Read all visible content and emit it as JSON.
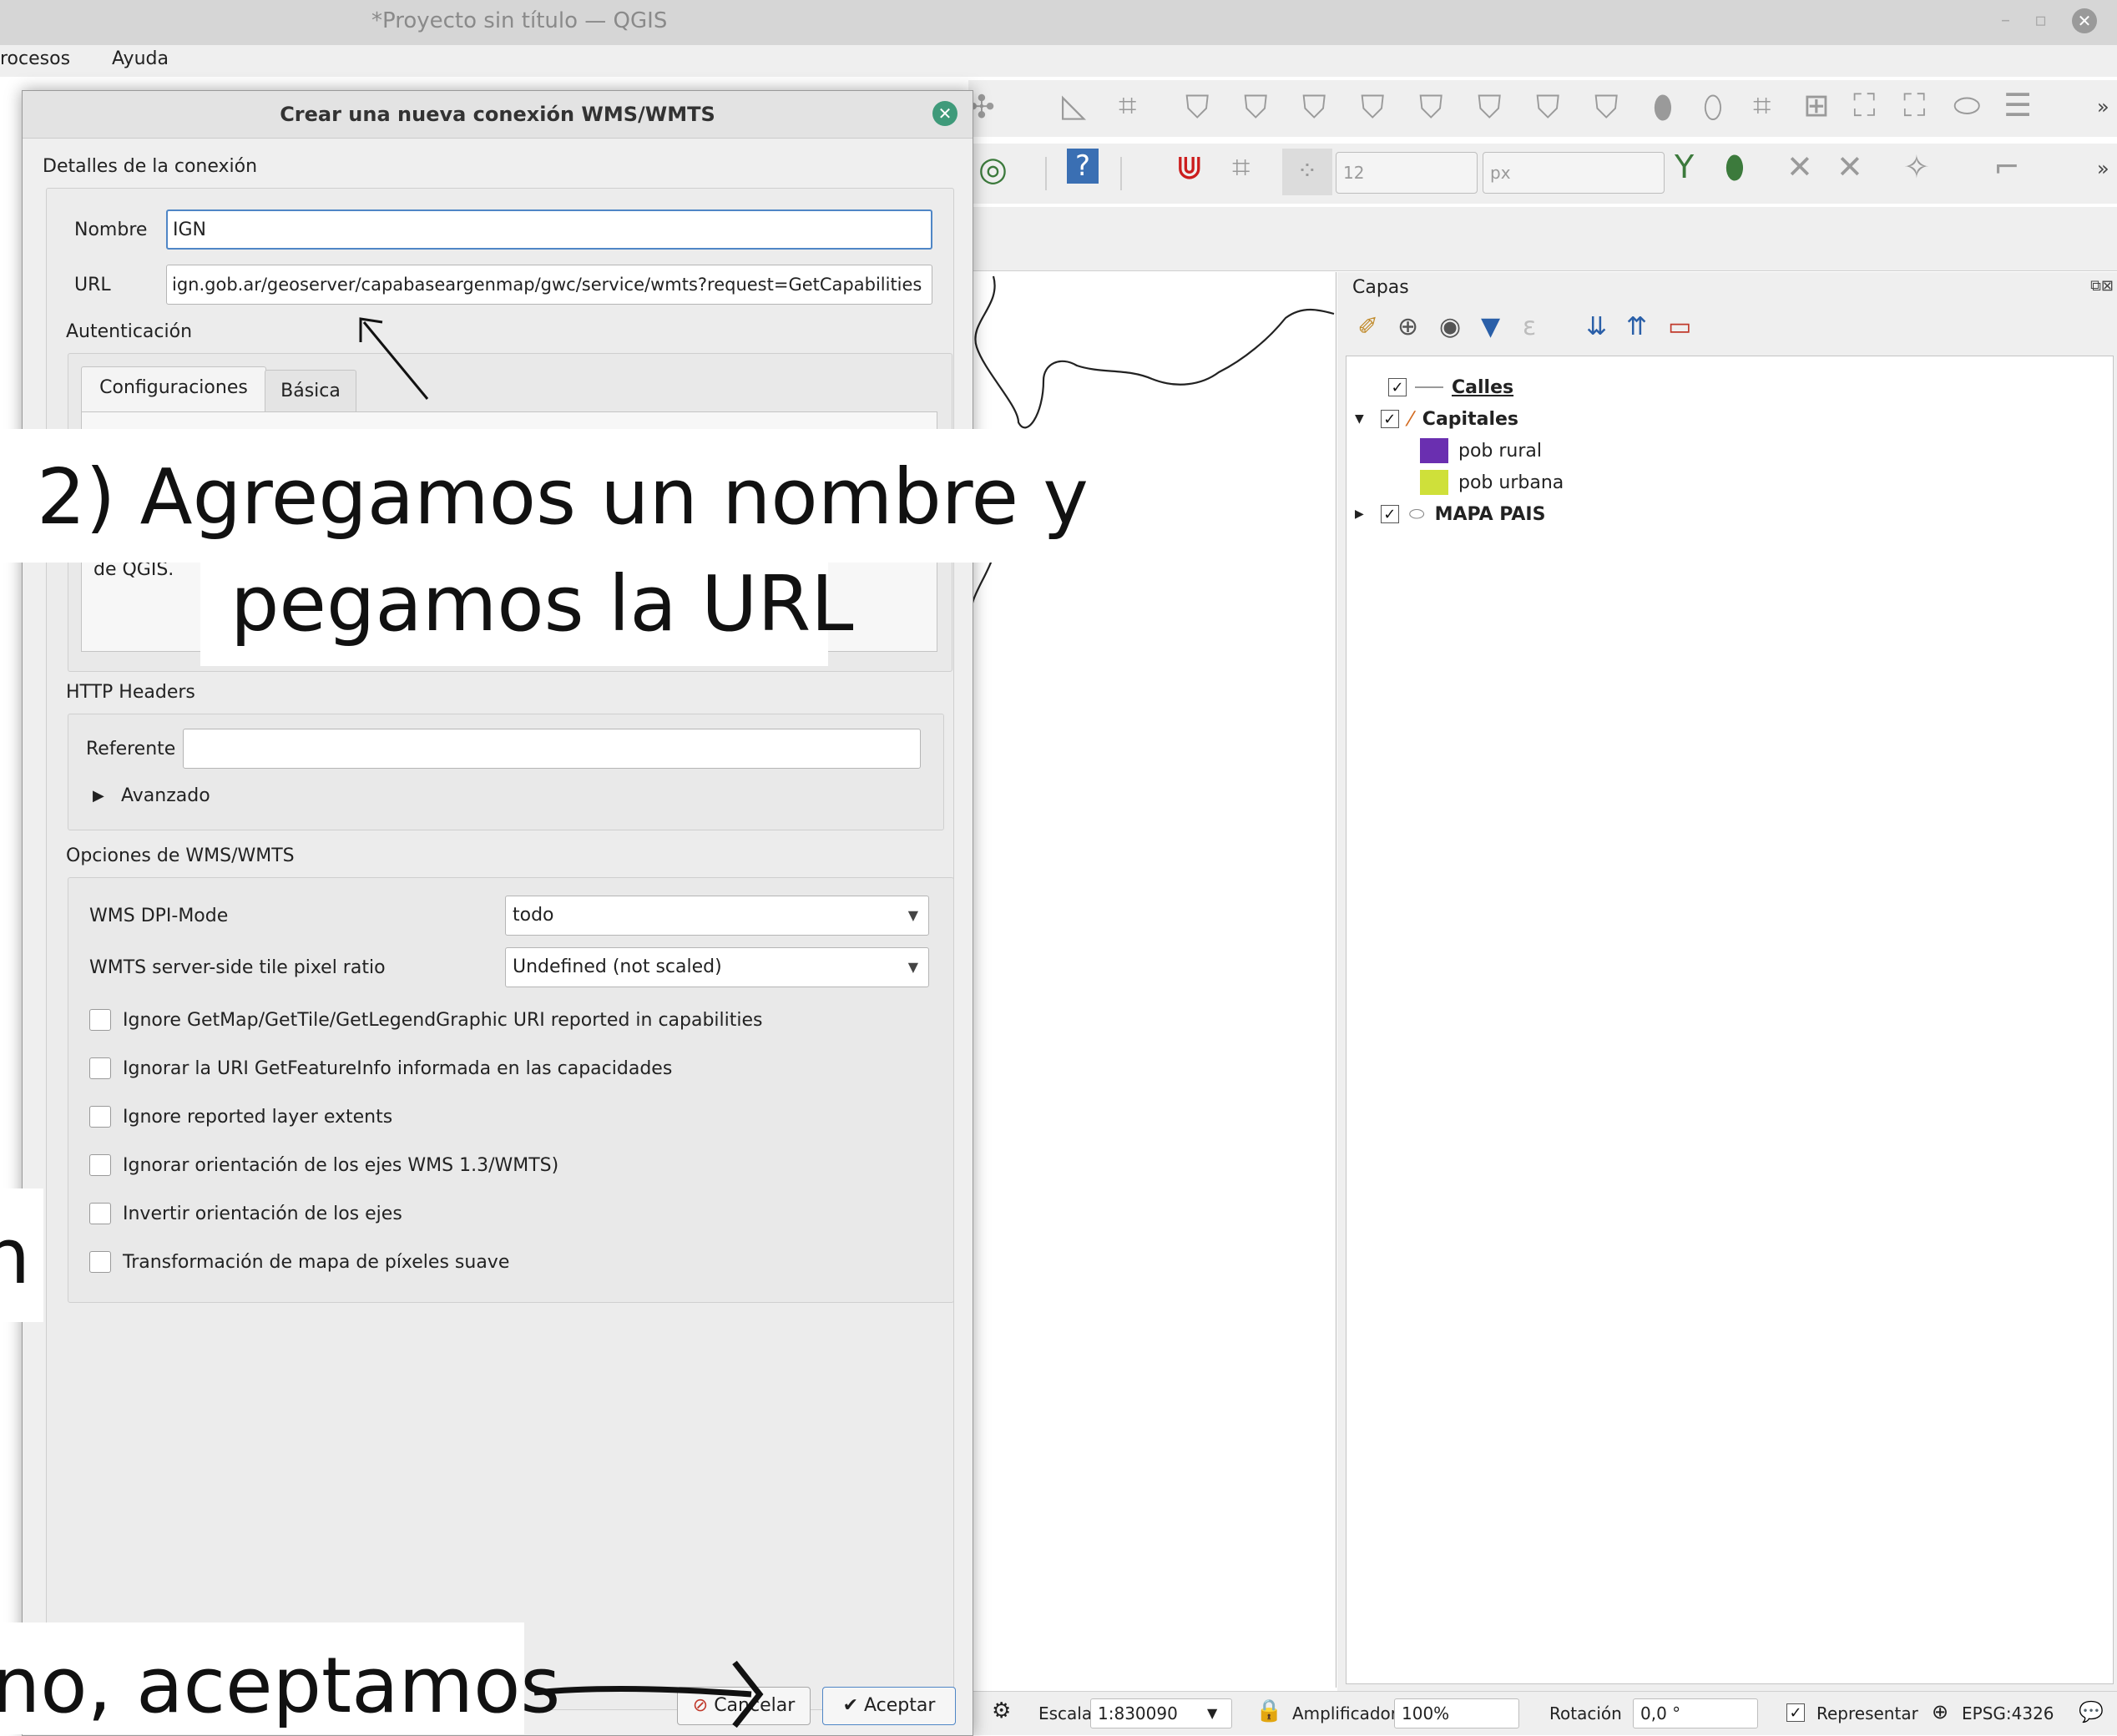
{
  "window": {
    "title": "*Proyecto sin título — QGIS",
    "min_glyph": "–",
    "max_glyph": "▫",
    "close_glyph": "✕"
  },
  "menu": {
    "items": [
      "rocesos",
      "Ayuda"
    ]
  },
  "toolbar": {
    "more_glyph": "»",
    "size_value": "12",
    "unit_value": "px"
  },
  "dialog": {
    "title": "Crear una nueva conexión WMS/WMTS",
    "section_details": "Detalles de la conexión",
    "name_label": "Nombre",
    "name_value": "IGN",
    "url_label": "URL",
    "url_value": "ign.gob.ar/geoserver/capabaseargenmap/gwc/service/wmts?request=GetCapabilities",
    "auth_label": "Autenticación",
    "tabs": [
      "Configuraciones",
      "Básica"
    ],
    "auth_text_tail": "de QGIS.",
    "http_headers_label": "HTTP Headers",
    "referer_label": "Referente",
    "referer_value": "",
    "advanced_label": "Avanzado",
    "wms_options_label": "Opciones de WMS/WMTS",
    "dpi_mode_label": "WMS DPI-Mode",
    "dpi_mode_value": "todo",
    "tile_ratio_label": "WMTS server-side tile pixel ratio",
    "tile_ratio_value": "Undefined (not scaled)",
    "checkboxes": [
      "Ignore GetMap/GetTile/GetLegendGraphic URI reported in capabilities",
      "Ignorar la URI GetFeatureInfo informada en las capacidades",
      "Ignore reported layer extents",
      "Ignorar orientación de los ejes WMS 1.3/WMTS)",
      "Invertir orientación de los ejes",
      "Transformación de mapa de píxeles suave"
    ],
    "cancel_label": "Cancelar",
    "accept_label": "Aceptar"
  },
  "layers": {
    "title": "Capas",
    "items": [
      {
        "name": "Calles",
        "checked": true
      },
      {
        "name": "Capitales",
        "checked": true
      },
      {
        "name": "pob rural",
        "color": "#6a2fb0"
      },
      {
        "name": "pob urbana",
        "color": "#cfe03a"
      },
      {
        "name": "MAPA PAIS",
        "checked": true
      }
    ]
  },
  "statusbar": {
    "scale_label": "Escala",
    "scale_value": "1:830090",
    "magnifier_label": "Amplificador",
    "magnifier_value": "100%",
    "rotation_label": "Rotación",
    "rotation_value": "0,0 °",
    "render_label": "Representar",
    "crs_value": "EPSG:4326"
  },
  "annotations": {
    "step2_line1": "2) Agregamos un nombre y",
    "step2_line2": "pegamos la URL",
    "step3_fragment": "no, aceptamos",
    "left_fragment": "n"
  },
  "colors": {
    "accent": "#4f86c6",
    "close_green": "#3f9a7a"
  }
}
